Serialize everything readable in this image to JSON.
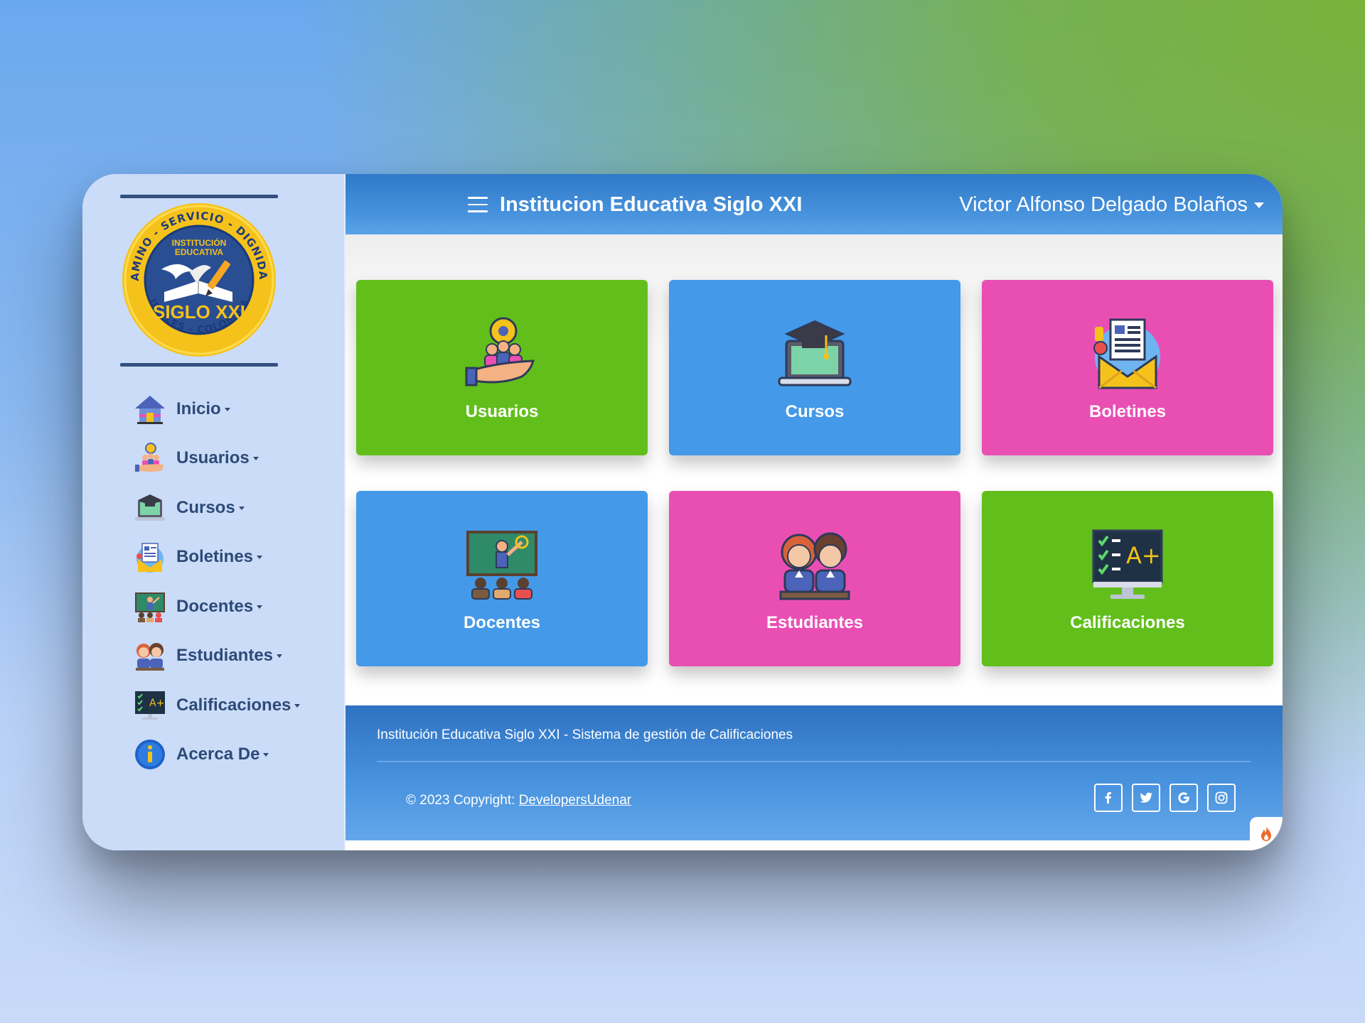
{
  "header": {
    "title": "Institucion Educativa Siglo XXI",
    "user_name": "Victor Alfonso Delgado Bolaños"
  },
  "logo": {
    "lettering": "CAMINO - SERVICIO - DIGNIDAD · INSTITUCIÓN EDUCATIVA · SIGLO XXI · IPIALES - COLOMBIA"
  },
  "sidebar": {
    "items": [
      {
        "label": "Inicio",
        "icon": "house-icon"
      },
      {
        "label": "Usuarios",
        "icon": "users-hand-icon"
      },
      {
        "label": "Cursos",
        "icon": "laptop-graduation-cap-icon"
      },
      {
        "label": "Boletines",
        "icon": "newsletter-envelope-icon"
      },
      {
        "label": "Docentes",
        "icon": "teacher-board-icon"
      },
      {
        "label": "Estudiantes",
        "icon": "students-icon"
      },
      {
        "label": "Calificaciones",
        "icon": "grades-monitor-icon"
      },
      {
        "label": "Acerca De",
        "icon": "info-icon"
      }
    ]
  },
  "tiles": [
    {
      "label": "Usuarios",
      "color": "#62bf1b"
    },
    {
      "label": "Cursos",
      "color": "#4499e8"
    },
    {
      "label": "Boletines",
      "color": "#e94fb3"
    },
    {
      "label": "Docentes",
      "color": "#4499e8"
    },
    {
      "label": "Estudiantes",
      "color": "#e94fb3"
    },
    {
      "label": "Calificaciones",
      "color": "#62bf1b"
    }
  ],
  "footer": {
    "description": "Institución Educativa Siglo XXI - Sistema de gestión de Calificaciones",
    "copyright_prefix": "© 2023 Copyright: ",
    "copyright_link": "DevelopersUdenar",
    "socials": [
      "facebook-icon",
      "twitter-icon",
      "google-icon",
      "instagram-icon"
    ]
  },
  "colors": {
    "topbar": "#3a86d6",
    "sidebar": "#cbdcf8",
    "green_tile": "#62bf1b",
    "blue_tile": "#4499e8",
    "pink_tile": "#e94fb3"
  }
}
